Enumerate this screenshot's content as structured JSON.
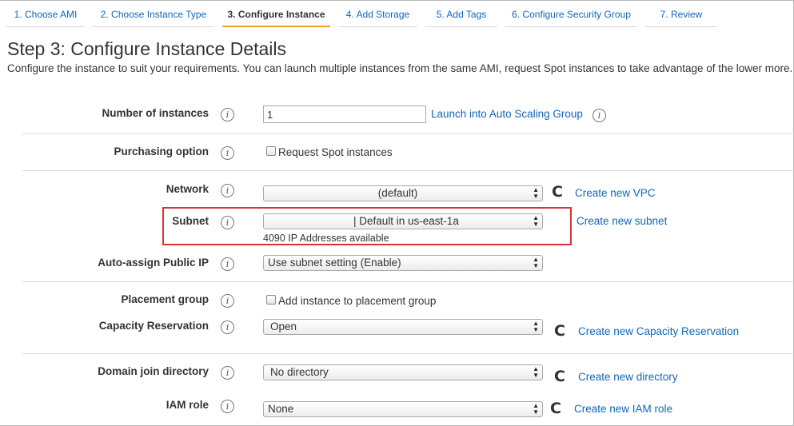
{
  "tabs": [
    {
      "label": "1. Choose AMI"
    },
    {
      "label": "2. Choose Instance Type"
    },
    {
      "label": "3. Configure Instance"
    },
    {
      "label": "4. Add Storage"
    },
    {
      "label": "5. Add Tags"
    },
    {
      "label": "6. Configure Security Group"
    },
    {
      "label": "7. Review"
    }
  ],
  "active_tab": "3. Configure Instance",
  "page": {
    "title": "Step 3: Configure Instance Details",
    "description": "Configure the instance to suit your requirements. You can launch multiple instances from the same AMI, request Spot instances to take advantage of the lower more."
  },
  "info_icon": "i",
  "refresh_icon": "C",
  "fields": {
    "instances": {
      "label": "Number of instances",
      "value": "1",
      "link": "Launch into Auto Scaling Group"
    },
    "purchasing": {
      "label": "Purchasing option",
      "checkbox_label": "Request Spot instances",
      "checked": false
    },
    "network": {
      "label": "Network",
      "value": "(default)",
      "link": "Create new VPC"
    },
    "subnet": {
      "label": "Subnet",
      "value": "| Default in us-east-1a",
      "note": "4090 IP Addresses available",
      "link": "Create new subnet"
    },
    "public_ip": {
      "label": "Auto-assign Public IP",
      "value": "Use subnet setting (Enable)"
    },
    "placement": {
      "label": "Placement group",
      "checkbox_label": "Add instance to placement group",
      "checked": false
    },
    "capacity": {
      "label": "Capacity Reservation",
      "value": "Open",
      "link": "Create new Capacity Reservation"
    },
    "domain": {
      "label": "Domain join directory",
      "value": "No directory",
      "link": "Create new directory"
    },
    "iam": {
      "label": "IAM role",
      "value": "None",
      "link": "Create new IAM role"
    }
  },
  "colors": {
    "link": "#1166bb",
    "active_tab_accent": "#f0a020",
    "highlight_border": "#d9333a"
  }
}
